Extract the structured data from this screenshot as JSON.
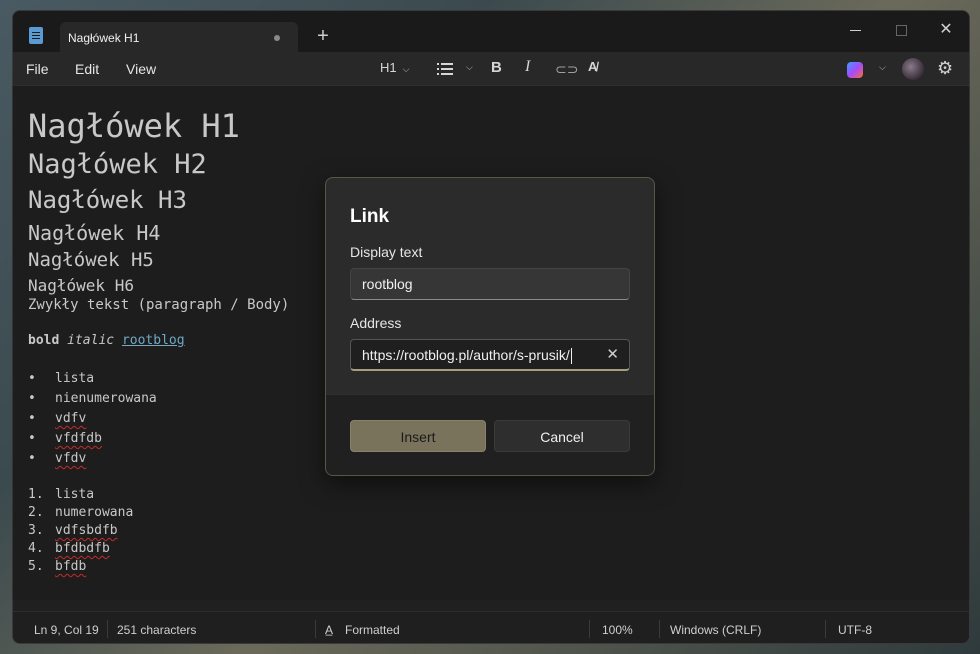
{
  "tab": {
    "title": "Nagłówek H1"
  },
  "menu": {
    "file": "File",
    "edit": "Edit",
    "view": "View"
  },
  "toolbar": {
    "heading": "H1"
  },
  "editor": {
    "h1": "Nagłówek H1",
    "h2": "Nagłówek H2",
    "h3": "Nagłówek H3",
    "h4": "Nagłówek H4",
    "h5": "Nagłówek H5",
    "h6": "Nagłówek H6",
    "paragraph": "Zwykły tekst (paragraph / Body)",
    "bold": "bold",
    "italic": "italic",
    "link": "rootblog",
    "bullets": [
      "lista",
      "nienumerowana",
      "vdfv",
      "vfdfdb",
      "vfdv"
    ],
    "numbered": [
      {
        "num": "1.",
        "text": "lista"
      },
      {
        "num": "2.",
        "text": "numerowana"
      },
      {
        "num": "3.",
        "text": "vdfsbdfb"
      },
      {
        "num": "4.",
        "text": "bfdbdfb"
      },
      {
        "num": "5.",
        "text": "bfdb"
      }
    ]
  },
  "status": {
    "position": "Ln 9, Col 19",
    "characters": "251 characters",
    "format": "Formatted",
    "zoom": "100%",
    "line_ending": "Windows (CRLF)",
    "encoding": "UTF-8"
  },
  "dialog": {
    "title": "Link",
    "display_label": "Display text",
    "display_value": "rootblog",
    "address_label": "Address",
    "address_value": "https://rootblog.pl/author/s-prusik/",
    "insert": "Insert",
    "cancel": "Cancel"
  },
  "icons": {
    "app": "notepad-icon",
    "close": "close-icon",
    "new_tab": "plus-icon",
    "list": "bullet-list-icon",
    "bold": "bold-icon",
    "italic": "italic-icon",
    "link": "link-icon",
    "spellcheck": "spellcheck-icon",
    "copilot": "copilot-icon",
    "settings": "gear-icon"
  },
  "colors": {
    "accent": "#7a735c",
    "link": "#7ab7d6",
    "spell_error": "#d32f2f"
  }
}
